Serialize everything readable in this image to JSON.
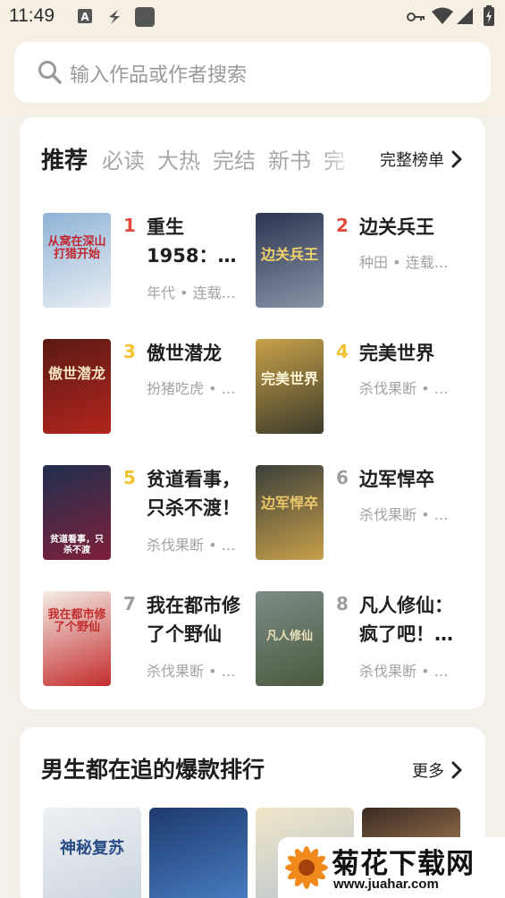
{
  "status_bar": {
    "time": "11:49",
    "left_icons": [
      "android-a-icon",
      "flash-icon",
      "app-square-icon"
    ],
    "right_icons": [
      "key-icon",
      "wifi-icon",
      "signal-icon",
      "battery-charging-icon"
    ]
  },
  "search": {
    "placeholder": "输入作品或作者搜索",
    "icon": "search-icon"
  },
  "ranking": {
    "tabs": [
      "推荐",
      "必读",
      "大热",
      "完结",
      "新书",
      "完"
    ],
    "active_tab": "推荐",
    "full_list_label": "完整榜单",
    "rank_colors": {
      "1": "#e14b3c",
      "2": "#e14b3c",
      "3": "#f2c230",
      "4": "#f2c230",
      "5": "#f2c230",
      "other": "#9e9e9e"
    },
    "books": [
      {
        "rank": "1",
        "title": "重生1958：…",
        "meta": "年代 • 连载…",
        "cover_text": "从窝在深山打猎开始",
        "cover_colors": [
          "#8fb3d6",
          "#e9eef3"
        ]
      },
      {
        "rank": "2",
        "title": "边关兵王",
        "meta": "种田 • 连载…",
        "cover_text": "边关兵王",
        "cover_colors": [
          "#2b3550",
          "#8a94a8"
        ]
      },
      {
        "rank": "3",
        "title": "傲世潜龙",
        "meta": "扮猪吃虎 • …",
        "cover_text": "傲世潜龙",
        "cover_colors": [
          "#5a1a14",
          "#b3251e"
        ]
      },
      {
        "rank": "4",
        "title": "完美世界",
        "meta": "杀伐果断 • …",
        "cover_text": "完美世界",
        "cover_colors": [
          "#c9a24a",
          "#3b3a2a"
        ]
      },
      {
        "rank": "5",
        "title": "贫道看事，只杀不渡！",
        "meta": "杀伐果断 • …",
        "cover_text": "贫道看事，只杀不渡",
        "cover_colors": [
          "#20304f",
          "#7e1f3a"
        ]
      },
      {
        "rank": "6",
        "title": "边军悍卒",
        "meta": "杀伐果断 • …",
        "cover_text": "边军悍卒",
        "cover_colors": [
          "#3a3f3a",
          "#c8a04a"
        ]
      },
      {
        "rank": "7",
        "title": "我在都市修了个野仙",
        "meta": "杀伐果断 • …",
        "cover_text": "我在都市修了个野仙",
        "cover_colors": [
          "#f4ece6",
          "#c32d2d"
        ]
      },
      {
        "rank": "8",
        "title": "凡人修仙：疯了吧！…",
        "meta": "杀伐果断 • …",
        "cover_text": "凡人修仙",
        "cover_colors": [
          "#7d8c86",
          "#4a5a3e"
        ]
      }
    ]
  },
  "section2": {
    "title": "男生都在追的爆款排行",
    "more_label": "更多",
    "thumbs": [
      {
        "cover_text": "神秘复苏",
        "colors": [
          "#eef1f4",
          "#c9d4de"
        ]
      },
      {
        "cover_text": "",
        "colors": [
          "#1d3a6e",
          "#4a7fc4"
        ]
      },
      {
        "cover_text": "",
        "colors": [
          "#f0e6c8",
          "#b9c4cf"
        ]
      },
      {
        "cover_text": "",
        "colors": [
          "#3a2a22",
          "#d7a36a"
        ]
      }
    ]
  },
  "watermark": {
    "title": "菊花下载网",
    "url": "www.juahar.com"
  }
}
